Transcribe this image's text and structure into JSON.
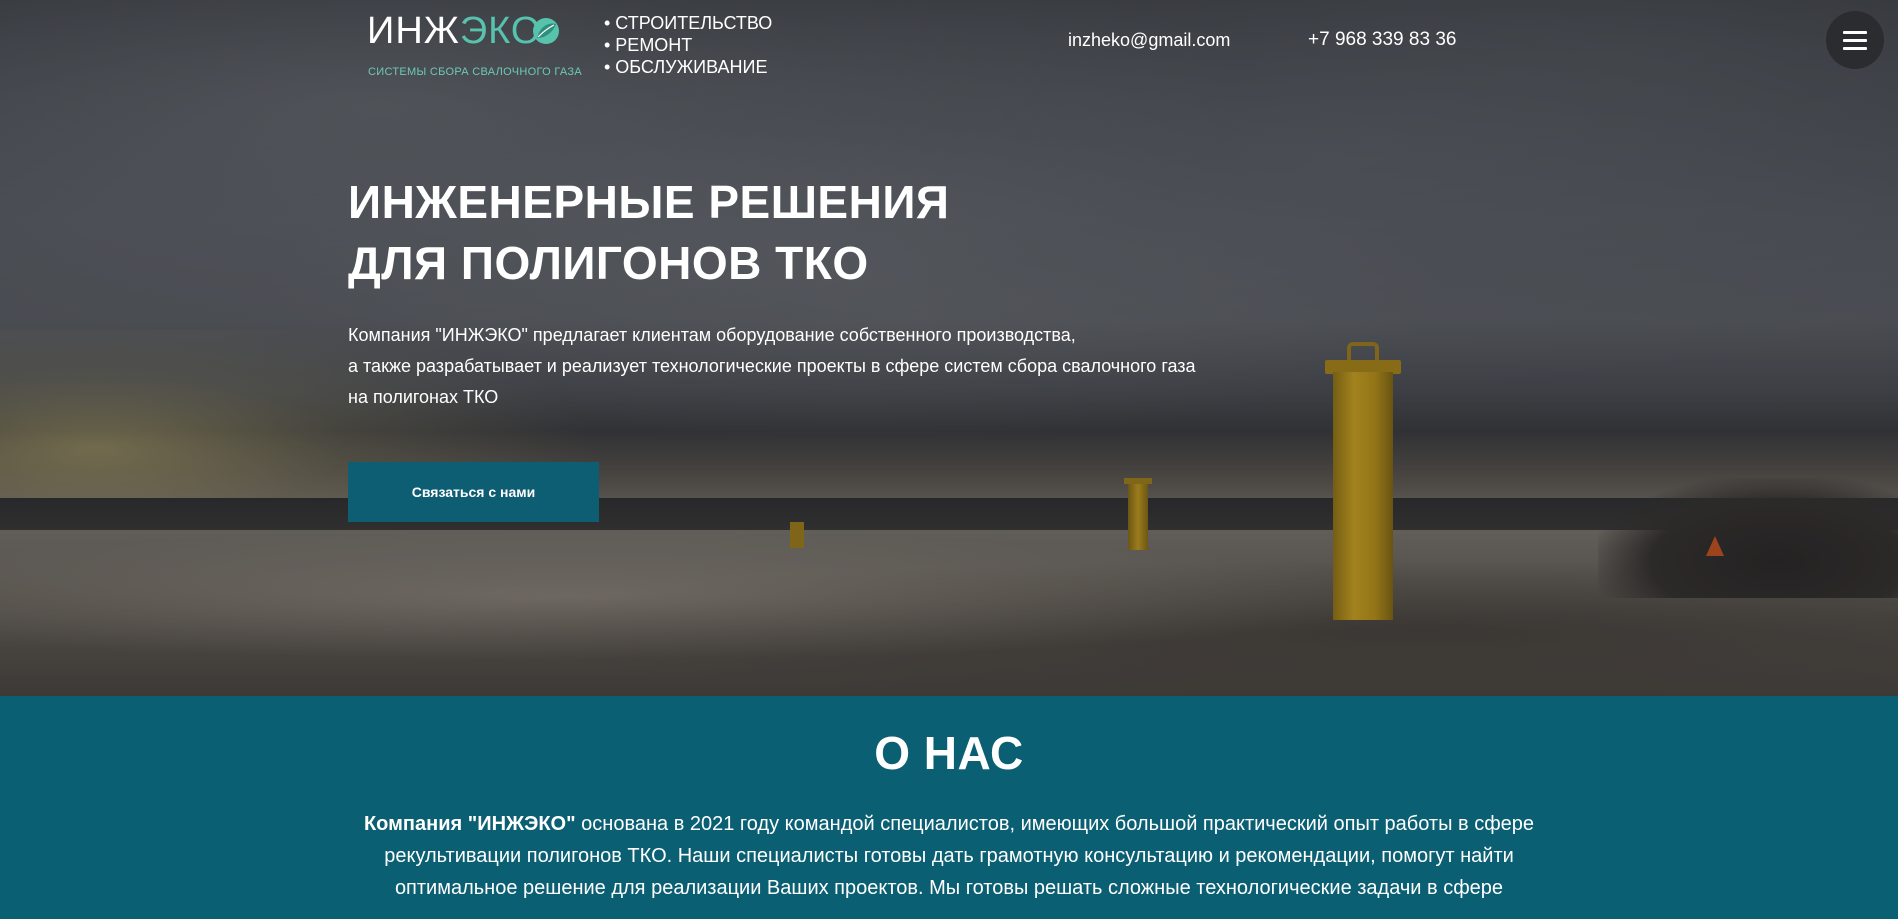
{
  "header": {
    "logo": {
      "name_main": "ИНЖ",
      "name_accent": "ЭКО",
      "subtitle": "СИСТЕМЫ СБОРА СВАЛОЧНОГО ГАЗА",
      "icon": "leaf-icon"
    },
    "services": [
      "• СТРОИТЕЛЬСТВО",
      "• РЕМОНТ",
      "• ОБСЛУЖИВАНИЕ"
    ],
    "email": "inzheko@gmail.com",
    "phone": "+7 968 339 83 36",
    "menu_icon": "hamburger-menu-icon"
  },
  "hero": {
    "title_lines": [
      "ИНЖЕНЕРНЫЕ РЕШЕНИЯ",
      "ДЛЯ ПОЛИГОНОВ ТКО"
    ],
    "description_lines": [
      "Компания \"ИНЖЭКО\" предлагает клиентам оборудование собственного производства,",
      "а также разрабатывает и реализует технологические проекты в сфере систем сбора свалочного газа",
      "на полигонах ТКО"
    ],
    "cta_label": "Связаться с нами"
  },
  "about": {
    "title": "О НАС",
    "company_name": "Компания \"ИНЖЭКО\"",
    "line1_rest": " основана в 2021 году командой специалистов, имеющих большой практический опыт работы в сфере",
    "line2": "рекультивации полигонов ТКО. Наши специалисты готовы дать грамотную консультацию и рекомендации, помогут найти",
    "line3": "оптимальное решение для реализации Ваших проектов. Мы готовы решать сложные технологические задачи в сфере"
  },
  "colors": {
    "accent_teal": "#0b5f73",
    "logo_green": "#57c3ad",
    "text": "#ffffff"
  }
}
